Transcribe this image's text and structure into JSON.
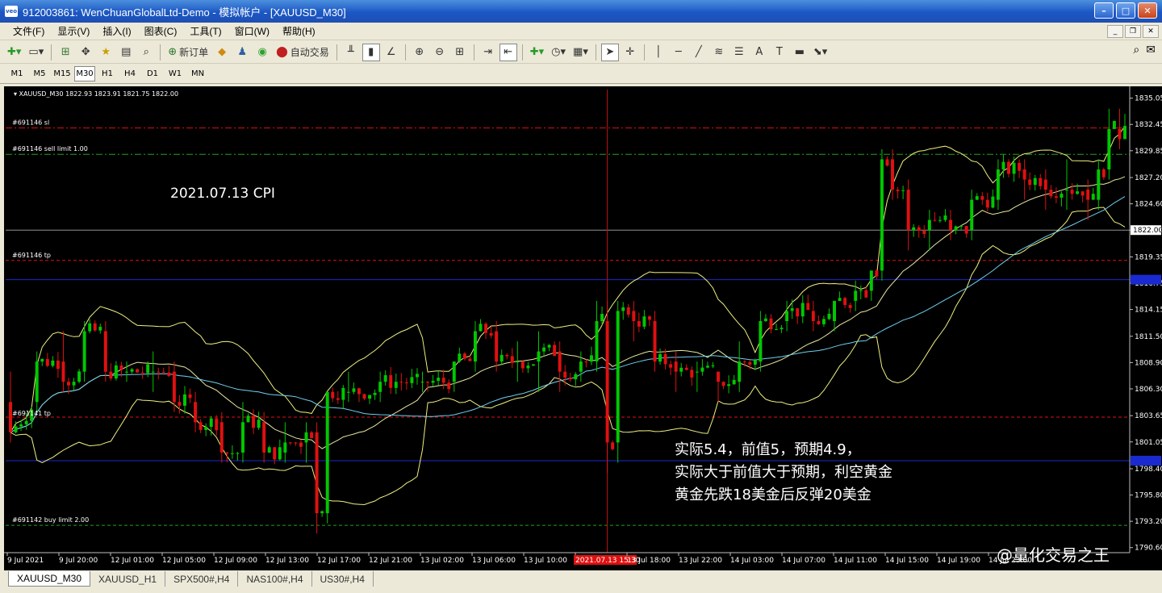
{
  "window": {
    "title": "912003861: WenChuanGlobalLtd-Demo - 模拟帐户 - [XAUUSD_M30]",
    "icon_text": "veo"
  },
  "menu": [
    "文件(F)",
    "显示(V)",
    "插入(I)",
    "图表(C)",
    "工具(T)",
    "窗口(W)",
    "帮助(H)"
  ],
  "toolbar": {
    "new_order_label": "新订单",
    "auto_trading_label": "自动交易"
  },
  "timeframes": [
    "M1",
    "M5",
    "M15",
    "M30",
    "H1",
    "H4",
    "D1",
    "W1",
    "MN"
  ],
  "active_timeframe": "M30",
  "chart": {
    "header": "XAUUSD_M30  1822.93 1823.91 1821.75 1822.00",
    "annotation_date": "2021.07.13  CPI",
    "annotation_lines": [
      "实际5.4，前值5，预期4.9，",
      "实际大于前值大于预期，利空黄金",
      "黄金先跌18美金后反弹20美金"
    ],
    "watermark": "@量化交易之王",
    "order_labels": {
      "sl": "#691146 sl",
      "sell_limit": "#691146 sell limit 1.00",
      "tp": "#691146 tp",
      "tp2": "#691141 tp",
      "buy_limit": "#691142 buy limit 2.00"
    },
    "current_price_label": "1822.00",
    "highlight_time": "2021.07.13 15:30",
    "colors": {
      "background": "#000000",
      "bull": "#00c800",
      "bear": "#e01010",
      "bands": "#f0f080",
      "ma_slow": "#1f3fb8",
      "ma_fast": "#6fd0f0"
    }
  },
  "chart_data": {
    "type": "candlestick",
    "symbol": "XAUUSD_M30",
    "y_ticks": [
      1835.05,
      1832.45,
      1829.85,
      1827.2,
      1824.6,
      1822.0,
      1819.35,
      1816.75,
      1814.15,
      1811.5,
      1808.9,
      1806.3,
      1803.65,
      1801.05,
      1798.4,
      1795.8,
      1793.2,
      1790.6
    ],
    "ylim": [
      1790.1,
      1835.9
    ],
    "x_ticks": [
      "9 Jul 2021",
      "9 Jul 20:00",
      "12 Jul 01:00",
      "12 Jul 05:00",
      "12 Jul 09:00",
      "12 Jul 13:00",
      "12 Jul 17:00",
      "12 Jul 21:00",
      "13 Jul 02:00",
      "13 Jul 06:00",
      "13 Jul 10:00",
      "2021.07.13 15:30",
      "13 Jul 18:00",
      "13 Jul 22:00",
      "14 Jul 03:00",
      "14 Jul 07:00",
      "14 Jul 11:00",
      "14 Jul 15:00",
      "14 Jul 19:00",
      "14 Jul 23:00"
    ],
    "levels": {
      "sl": 1832.1,
      "sell_limit": 1829.5,
      "current": 1822.0,
      "tp": 1819.0,
      "blue_line": 1817.1,
      "tp2": 1803.5,
      "blue_line2": 1799.2,
      "buy_limit": 1792.8
    },
    "anchors": [
      [
        0,
        1805,
        1802,
        1808,
        1801
      ],
      [
        5,
        1805,
        1809,
        1810,
        1804
      ],
      [
        10,
        1809,
        1807,
        1812,
        1806
      ],
      [
        14,
        1808,
        1812,
        1813,
        1807
      ],
      [
        18,
        1812,
        1808,
        1813,
        1807
      ],
      [
        22,
        1808,
        1808,
        1809,
        1807
      ],
      [
        27,
        1808,
        1808,
        1810,
        1806
      ],
      [
        31,
        1808,
        1805,
        1809,
        1804
      ],
      [
        35,
        1805,
        1803,
        1806,
        1802
      ],
      [
        40,
        1803,
        1800,
        1804,
        1799
      ],
      [
        44,
        1800,
        1803,
        1805,
        1799
      ],
      [
        48,
        1803,
        1800,
        1804,
        1799
      ],
      [
        52,
        1800,
        1801,
        1803,
        1799
      ],
      [
        56,
        1801,
        1802,
        1803,
        1799
      ],
      [
        58,
        1802,
        1794,
        1803,
        1792
      ],
      [
        60,
        1794,
        1806,
        1806,
        1793
      ],
      [
        64,
        1806,
        1806,
        1808,
        1805
      ],
      [
        70,
        1806,
        1807,
        1808,
        1805
      ],
      [
        78,
        1807,
        1807,
        1808,
        1806
      ],
      [
        84,
        1807,
        1809,
        1809,
        1806
      ],
      [
        88,
        1809,
        1812,
        1813,
        1808
      ],
      [
        92,
        1812,
        1809,
        1813,
        1808
      ],
      [
        96,
        1809,
        1809,
        1811,
        1807
      ],
      [
        100,
        1809,
        1810,
        1812,
        1806
      ],
      [
        104,
        1810,
        1808,
        1811,
        1806
      ],
      [
        108,
        1808,
        1809,
        1810,
        1807
      ],
      [
        111,
        1809,
        1813,
        1815,
        1808
      ],
      [
        113,
        1813,
        1801,
        1815,
        1798
      ],
      [
        115,
        1801,
        1814,
        1815,
        1799
      ],
      [
        118,
        1814,
        1813,
        1815,
        1811
      ],
      [
        122,
        1813,
        1809,
        1814,
        1808
      ],
      [
        126,
        1809,
        1808,
        1810,
        1806
      ],
      [
        130,
        1808,
        1808,
        1809,
        1806
      ],
      [
        134,
        1808,
        1807,
        1808,
        1805
      ],
      [
        138,
        1807,
        1809,
        1811,
        1806
      ],
      [
        142,
        1809,
        1813,
        1814,
        1808
      ],
      [
        147,
        1813,
        1814,
        1815,
        1812
      ],
      [
        152,
        1814,
        1813,
        1815,
        1812
      ],
      [
        156,
        1813,
        1815,
        1815,
        1812
      ],
      [
        160,
        1815,
        1816,
        1817,
        1814
      ],
      [
        163,
        1816,
        1818,
        1818,
        1815
      ],
      [
        165,
        1818,
        1829,
        1830,
        1817
      ],
      [
        167,
        1829,
        1826,
        1830,
        1825
      ],
      [
        170,
        1826,
        1822,
        1827,
        1820
      ],
      [
        174,
        1822,
        1823,
        1824,
        1820
      ],
      [
        178,
        1823,
        1822,
        1824,
        1821
      ],
      [
        182,
        1822,
        1825,
        1826,
        1821
      ],
      [
        187,
        1825,
        1828,
        1829,
        1824
      ],
      [
        192,
        1828,
        1827,
        1829,
        1825
      ],
      [
        196,
        1827,
        1826,
        1828,
        1824
      ],
      [
        200,
        1826,
        1826,
        1829,
        1824
      ],
      [
        204,
        1826,
        1825,
        1827,
        1823
      ],
      [
        206,
        1825,
        1828,
        1829,
        1824
      ],
      [
        208,
        1828,
        1832,
        1834,
        1827
      ],
      [
        210,
        1832,
        1831,
        1834,
        1830
      ]
    ]
  }
}
